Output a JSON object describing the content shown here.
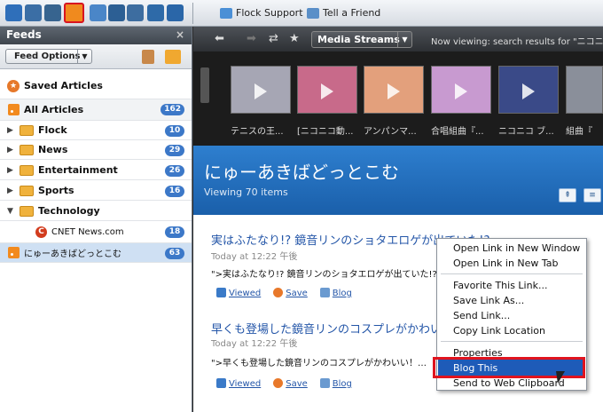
{
  "toolbar": {
    "icons": [
      "globe-icon",
      "people-icon",
      "camera-icon",
      "rss-icon",
      "star-icon",
      "pin-icon",
      "bag-icon",
      "pen-icon",
      "upload-icon"
    ],
    "bookmarks": [
      {
        "label": "Flock Support",
        "icon": "flock-icon"
      },
      {
        "label": "Tell a Friend",
        "icon": "tell-icon"
      }
    ]
  },
  "sidebar": {
    "title": "Feeds",
    "close": "×",
    "feed_options_label": "Feed Options",
    "items": [
      {
        "label": "Saved Articles",
        "count": ""
      },
      {
        "label": "All Articles",
        "count": "162"
      },
      {
        "label": "Flock",
        "count": "10"
      },
      {
        "label": "News",
        "count": "29"
      },
      {
        "label": "Entertainment",
        "count": "26"
      },
      {
        "label": "Sports",
        "count": "16"
      },
      {
        "label": "Technology",
        "count": ""
      },
      {
        "label": "CNET News.com",
        "count": "18"
      },
      {
        "label": "にゅーあきばどっとこむ",
        "count": "63"
      }
    ]
  },
  "navbar": {
    "media_streams_label": "Media Streams",
    "now_viewing": "Now viewing: search results for \"ニコニ"
  },
  "strip": {
    "captions": [
      "テニスの王...",
      "[ニコニコ動...",
      "アンパンマ...",
      "合唱組曲『...",
      "ニコニコ ブ...",
      "組曲『"
    ]
  },
  "feed": {
    "title": "にゅーあきばどっとこむ",
    "subtitle": "Viewing 70 items",
    "items": [
      {
        "title": "実はふたなり!? 鏡音リンのショタエロゲが出ていた!?",
        "date": "Today at 12:22 午後",
        "body": "\">実はふたなり!? 鏡音リンのショタエロゲが出ていた!?…",
        "viewed": "Viewed",
        "save": "Save",
        "blog": "Blog"
      },
      {
        "title": "早くも登場した鏡音リンのコスプレがかわいい",
        "date": "Today at 12:22 午後",
        "body": "\">早くも登場した鏡音リンのコスプレがかわいい！…",
        "viewed": "Viewed",
        "save": "Save",
        "blog": "Blog"
      }
    ]
  },
  "context_menu": {
    "items": [
      "Open Link in New Window",
      "Open Link in New Tab",
      "Favorite This Link...",
      "Save Link As...",
      "Send Link...",
      "Copy Link Location",
      "Properties",
      "Blog This",
      "Send to Web Clipboard"
    ],
    "highlighted": "Blog This"
  },
  "colors": {
    "accent": "#1e5bb8",
    "banner": "#2e7fcf",
    "badge": "#3c78c8",
    "highlight_box": "#e0141e"
  }
}
